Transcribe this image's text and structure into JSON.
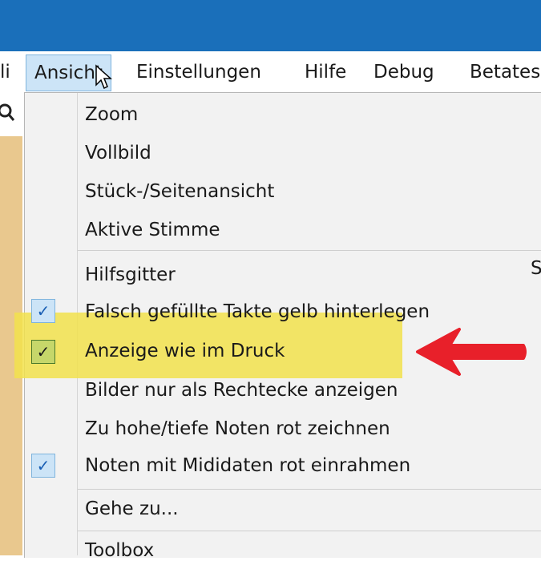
{
  "menubar": {
    "items": [
      {
        "label": "li"
      },
      {
        "label": "Ansicht"
      },
      {
        "label": "Einstellungen"
      },
      {
        "label": "Hilfe"
      },
      {
        "label": "Debug"
      },
      {
        "label": "Betates"
      }
    ]
  },
  "dropdown": {
    "items": [
      {
        "label": "Zoom",
        "checked": false
      },
      {
        "label": "Vollbild",
        "checked": false
      },
      {
        "label": "Stück-/Seitenansicht",
        "checked": false
      },
      {
        "label": "Aktive Stimme",
        "checked": false
      },
      {
        "label": "Hilfsgitter",
        "checked": false
      },
      {
        "label": "Falsch gefüllte Takte gelb hinterlegen",
        "checked": true
      },
      {
        "label": "Anzeige wie im Druck",
        "checked": true
      },
      {
        "label": "Bilder nur als Rechtecke anzeigen",
        "checked": false
      },
      {
        "label": "Zu hohe/tiefe Noten rot zeichnen",
        "checked": false
      },
      {
        "label": "Noten mit Mididaten rot einrahmen",
        "checked": true
      },
      {
        "label": "Gehe zu...",
        "checked": false
      },
      {
        "label": "Toolbox",
        "checked": false
      }
    ]
  },
  "colors": {
    "titlebar": "#1a6fba",
    "highlight": "#f2e24c",
    "arrow": "#e8202a",
    "check": "#1a5fb4"
  }
}
